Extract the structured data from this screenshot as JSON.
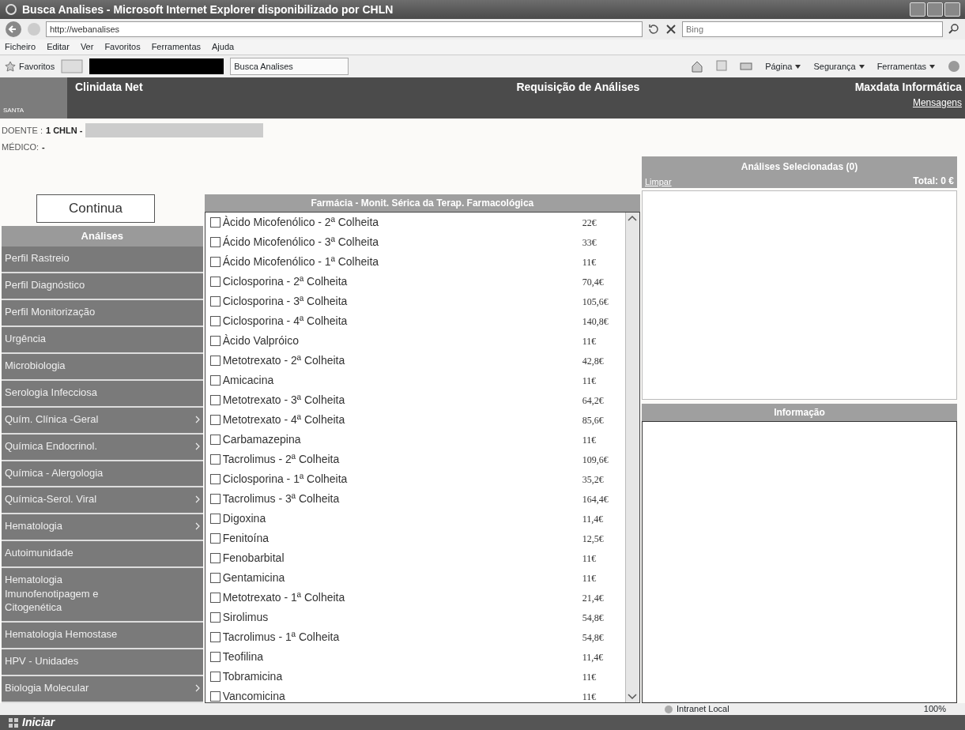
{
  "window": {
    "title": "Busca Analises - Microsoft Internet Explorer disponibilizado por CHLN"
  },
  "address_bar": {
    "url": "http://webanalises",
    "search_placeholder": "Bing"
  },
  "menu_bar": [
    "Ficheiro",
    "Editar",
    "Ver",
    "Favoritos",
    "Ferramentas",
    "Ajuda"
  ],
  "favorites_bar": {
    "favorites": "Favoritos",
    "tab": "Busca Analises",
    "tools": [
      "Página",
      "Segurança",
      "Ferramentas"
    ]
  },
  "app_header": {
    "logo": "SANTA",
    "product": "Clinidata Net",
    "title": "Requisição de Análises",
    "vendor": "Maxdata Informática",
    "messages": "Mensagens"
  },
  "patient": {
    "doente_label": "DOENTE :",
    "doente_value": "1 CHLN -",
    "medico_label": "MÉDICO:",
    "medico_value": "-"
  },
  "continue_button": "Continua",
  "sidebar": {
    "title": "Análises",
    "items": [
      {
        "label": "Perfil Rastreio",
        "submenu": false
      },
      {
        "label": "Perfil Diagnóstico",
        "submenu": false
      },
      {
        "label": "Perfil Monitorização",
        "submenu": false
      },
      {
        "label": "Urgência",
        "submenu": false
      },
      {
        "label": "Microbiologia",
        "submenu": false
      },
      {
        "label": "Serologia Infecciosa",
        "submenu": false
      },
      {
        "label": "Quím. Clínica -Geral",
        "submenu": true
      },
      {
        "label": "Química Endocrinol.",
        "submenu": true
      },
      {
        "label": "Química - Alergologia",
        "submenu": false
      },
      {
        "label": "Química-Serol. Viral",
        "submenu": true
      },
      {
        "label": "Hematologia",
        "submenu": true
      },
      {
        "label": "Autoimunidade",
        "submenu": false
      },
      {
        "label": "Hematologia Imunofenotipagem e Citogenética",
        "submenu": false
      },
      {
        "label": "Hematologia Hemostase",
        "submenu": false
      },
      {
        "label": "HPV - Unidades",
        "submenu": false
      },
      {
        "label": "Biologia Molecular",
        "submenu": true
      }
    ]
  },
  "analyses": {
    "title": "Farmácia - Monit. Sérica da Terap. Farmacológica",
    "rows": [
      {
        "name": "Àcido Micofenólico - 2ª Colheita",
        "price": "22€",
        "checked": false
      },
      {
        "name": "Ácido Micofenólico - 3ª Colheita",
        "price": "33€",
        "checked": false
      },
      {
        "name": "Ácido Micofenólico - 1ª Colheita",
        "price": "11€",
        "checked": false
      },
      {
        "name": "Ciclosporina - 2ª Colheita",
        "price": "70,4€",
        "checked": false
      },
      {
        "name": "Ciclosporina - 3ª Colheita",
        "price": "105,6€",
        "checked": false
      },
      {
        "name": "Ciclosporina - 4ª Colheita",
        "price": "140,8€",
        "checked": false
      },
      {
        "name": "Àcido Valpróico",
        "price": "11€",
        "checked": false
      },
      {
        "name": "Metotrexato - 2ª Colheita",
        "price": "42,8€",
        "checked": false
      },
      {
        "name": "Amicacina",
        "price": "11€",
        "checked": false
      },
      {
        "name": "Metotrexato - 3ª Colheita",
        "price": "64,2€",
        "checked": false
      },
      {
        "name": "Metotrexato - 4ª Colheita",
        "price": "85,6€",
        "checked": false
      },
      {
        "name": "Carbamazepina",
        "price": "11€",
        "checked": false
      },
      {
        "name": "Tacrolimus - 2ª Colheita",
        "price": "109,6€",
        "checked": false
      },
      {
        "name": "Ciclosporina - 1ª Colheita",
        "price": "35,2€",
        "checked": false
      },
      {
        "name": "Tacrolimus - 3ª Colheita",
        "price": "164,4€",
        "checked": false
      },
      {
        "name": "Digoxina",
        "price": "11,4€",
        "checked": false
      },
      {
        "name": "Fenitoína",
        "price": "12,5€",
        "checked": false
      },
      {
        "name": "Fenobarbital",
        "price": "11€",
        "checked": false
      },
      {
        "name": "Gentamicina",
        "price": "11€",
        "checked": false
      },
      {
        "name": "Metotrexato - 1ª Colheita",
        "price": "21,4€",
        "checked": false
      },
      {
        "name": "Sirolimus",
        "price": "54,8€",
        "checked": false
      },
      {
        "name": "Tacrolimus - 1ª Colheita",
        "price": "54,8€",
        "checked": false
      },
      {
        "name": "Teofilina",
        "price": "11,4€",
        "checked": false
      },
      {
        "name": "Tobramicina",
        "price": "11€",
        "checked": false
      },
      {
        "name": "Vancomicina",
        "price": "11€",
        "checked": false
      }
    ]
  },
  "selected_panel": {
    "title": "Análises Selecionadas (0)",
    "clear_link": "Limpar",
    "total": "Total: 0 €"
  },
  "info_panel": {
    "title": "Informação"
  },
  "status_bar": {
    "zone": "Intranet Local",
    "zoom": "100%"
  },
  "taskbar": {
    "start": "Iniciar"
  }
}
